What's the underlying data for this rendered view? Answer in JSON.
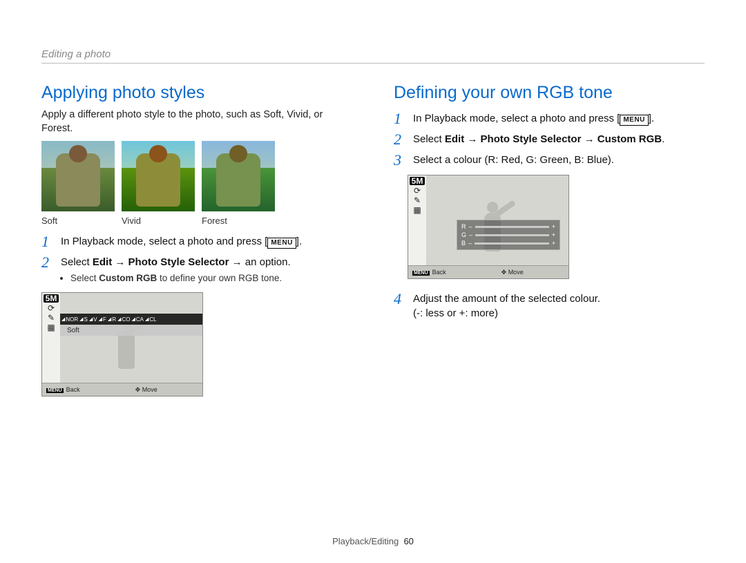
{
  "breadcrumb": "Editing a photo",
  "left": {
    "heading": "Applying photo styles",
    "intro": "Apply a different photo style to the photo, such as Soft, Vivid, or Forest.",
    "thumbs": [
      {
        "label": "Soft"
      },
      {
        "label": "Vivid"
      },
      {
        "label": "Forest"
      }
    ],
    "steps": {
      "s1_a": "In Playback mode, select a photo and press [",
      "s1_menu": "MENU",
      "s1_b": "].",
      "s2_a": "Select ",
      "s2_b": "Edit",
      "s2_c": " → ",
      "s2_d": "Photo Style Selector",
      "s2_e": " → an option.",
      "bullet_a": "Select ",
      "bullet_b": "Custom RGB",
      "bullet_c": " to define your own RGB tone."
    },
    "lcd": {
      "badge": "5M",
      "chips": [
        "NOR",
        "S",
        "V",
        "F",
        "R",
        "CO",
        "CA",
        "CL"
      ],
      "soft_label": "Soft",
      "back": "Back",
      "move": "Move",
      "menu_label": "MENU"
    }
  },
  "right": {
    "heading": "Defining your own RGB tone",
    "steps": {
      "s1_a": "In Playback mode, select a photo and press [",
      "s1_menu": "MENU",
      "s1_b": "].",
      "s2_a": "Select ",
      "s2_b": "Edit",
      "s2_c": " → ",
      "s2_d": "Photo Style Selector",
      "s2_e": " → ",
      "s2_f": "Custom RGB",
      "s2_g": ".",
      "s3": "Select a colour (R: Red, G: Green, B: Blue).",
      "s4_a": "Adjust the amount of the selected colour.",
      "s4_b": "(-: less or +: more)"
    },
    "lcd": {
      "badge": "5M",
      "r_label": "R",
      "g_label": "G",
      "b_label": "B",
      "minus": "–",
      "plus": "+",
      "back": "Back",
      "move": "Move",
      "menu_label": "MENU"
    }
  },
  "footer": {
    "section": "Playback/Editing",
    "page": "60"
  },
  "nums": {
    "n1": "1",
    "n2": "2",
    "n3": "3",
    "n4": "4"
  }
}
